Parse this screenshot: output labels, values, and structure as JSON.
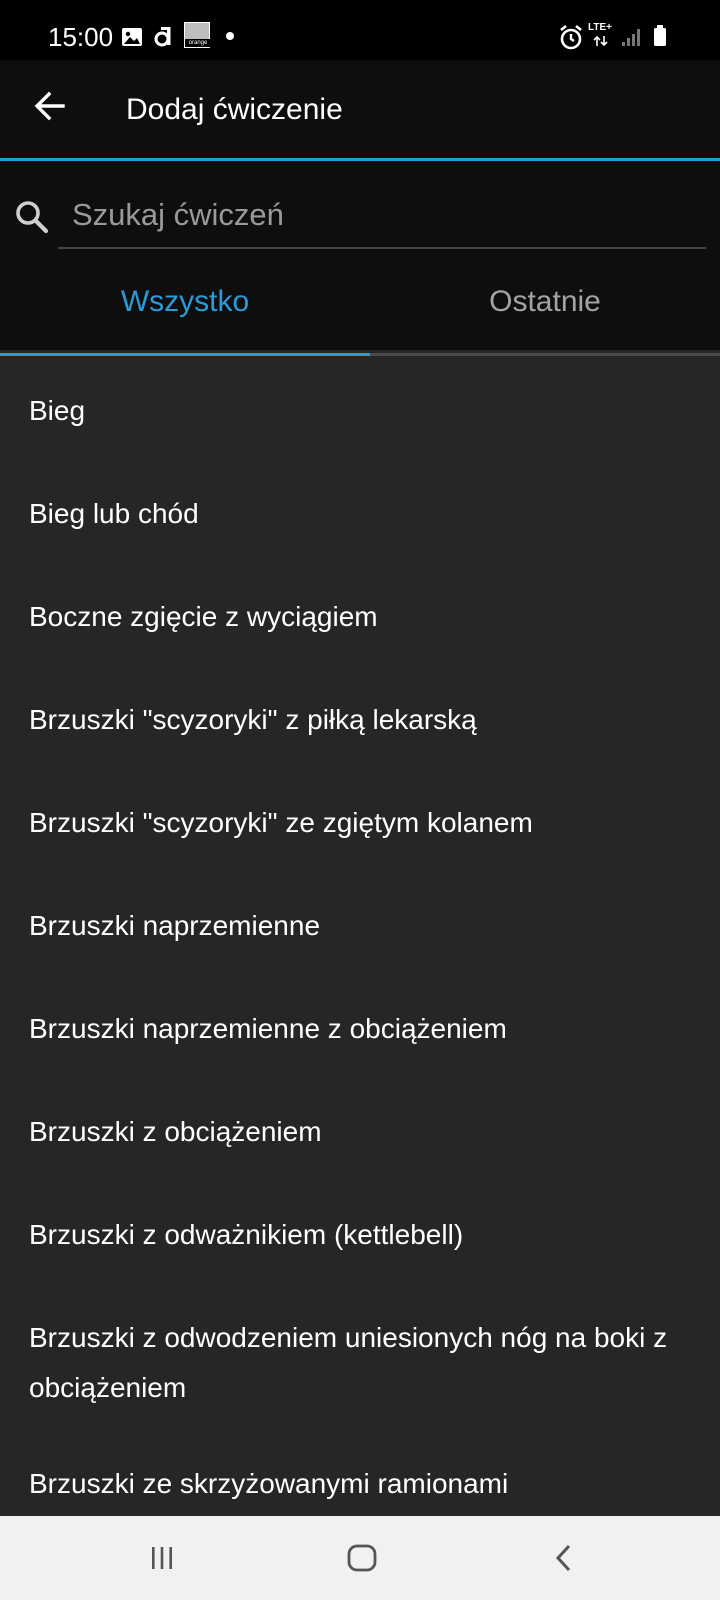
{
  "status_bar": {
    "time": "15:00",
    "carrier_badge": "orange",
    "network": "LTE+"
  },
  "app_bar": {
    "title": "Dodaj ćwiczenie"
  },
  "search": {
    "placeholder": "Szukaj ćwiczeń"
  },
  "tabs": [
    {
      "label": "Wszystko",
      "active": true
    },
    {
      "label": "Ostatnie",
      "active": false
    }
  ],
  "colors": {
    "accent": "#2a9bd8",
    "background": "#262626",
    "header": "#0e0e0e"
  },
  "exercises": [
    "Bieg",
    "Bieg lub chód",
    "Boczne zgięcie z wyciągiem",
    "Brzuszki \"scyzoryki\" z piłką lekarską",
    "Brzuszki \"scyzoryki\" ze zgiętym kolanem",
    "Brzuszki naprzemienne",
    "Brzuszki naprzemienne z obciążeniem",
    "Brzuszki z obciążeniem",
    "Brzuszki z odważnikiem (kettlebell)",
    "Brzuszki z odwodzeniem uniesionych nóg na boki z obciążeniem",
    "Brzuszki ze skrzyżowanymi ramionami"
  ],
  "icons": {
    "back": "arrow-left-icon",
    "search": "search-icon",
    "nav_recent": "recent-apps-icon",
    "nav_home": "home-icon",
    "nav_back": "back-chevron-icon"
  }
}
